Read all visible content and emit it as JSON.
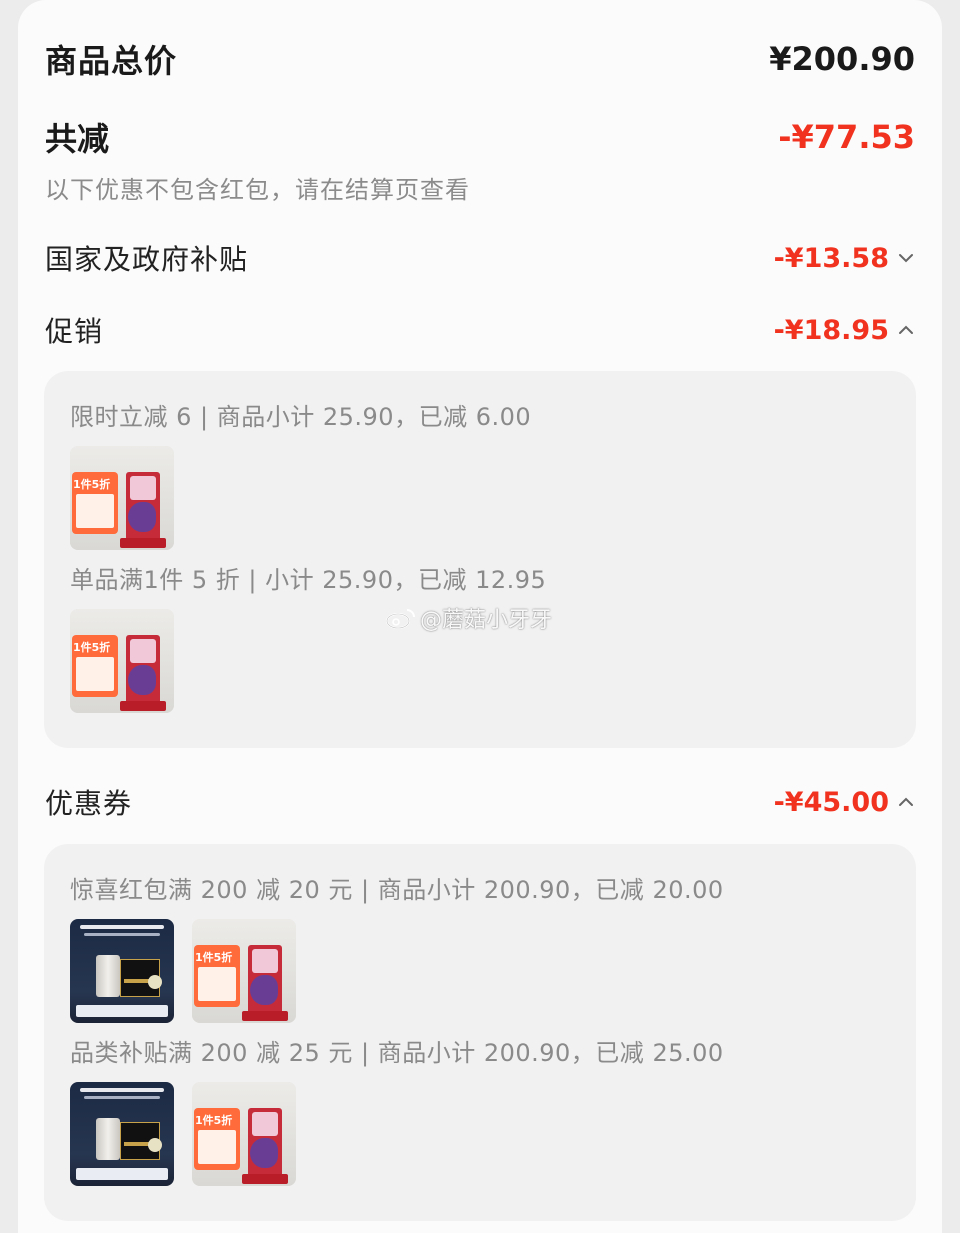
{
  "summary": {
    "total_label": "商品总价",
    "total_value": "¥200.90",
    "reduce_label": "共减",
    "reduce_value": "-¥77.53",
    "note": "以下优惠不包含红包，请在结算页查看"
  },
  "sections": {
    "subsidy": {
      "label": "国家及政府补贴",
      "value": "-¥13.58",
      "expanded": false
    },
    "promo": {
      "label": "促销",
      "value": "-¥18.95",
      "expanded": true,
      "items": [
        {
          "text": "限时立减 6 | 商品小计 25.90，已减 6.00",
          "thumbs": [
            "promo-product"
          ]
        },
        {
          "text": "单品满1件 5 折 | 小计 25.90，已减 12.95",
          "thumbs": [
            "promo-product"
          ]
        }
      ]
    },
    "coupon": {
      "label": "优惠券",
      "value": "-¥45.00",
      "expanded": true,
      "items": [
        {
          "text": "惊喜红包满 200 减 20 元 | 商品小计 200.90，已减 20.00",
          "thumbs": [
            "dark-product",
            "promo-product"
          ]
        },
        {
          "text": "品类补贴满 200 减 25 元 | 商品小计 200.90，已减 25.00",
          "thumbs": [
            "dark-product",
            "promo-product"
          ]
        }
      ]
    }
  },
  "watermark": "@蘑菇小牙牙",
  "colors": {
    "accent": "#f0321e",
    "muted": "#8a8a8a",
    "panel": "#f1f1f1"
  },
  "icons": {
    "collapsed": "chevron-down-icon",
    "expanded": "chevron-up-icon",
    "watermark": "weibo-icon"
  }
}
